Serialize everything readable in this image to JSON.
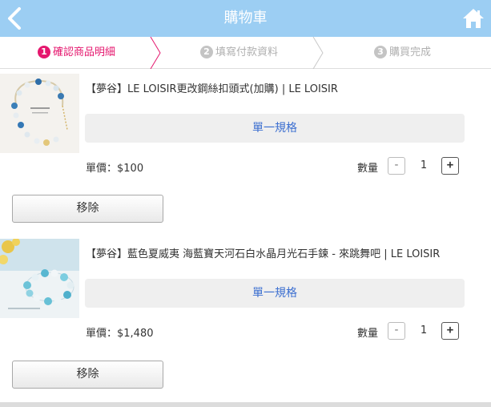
{
  "header": {
    "title": "購物車",
    "back_icon": "chevron-left-icon",
    "home_icon": "home-icon",
    "bg_color": "#9ccef3"
  },
  "steps": [
    {
      "num": "1",
      "label": "確認商品明細",
      "active": true
    },
    {
      "num": "2",
      "label": "填寫付款資料",
      "active": false
    },
    {
      "num": "3",
      "label": "購買完成",
      "active": false
    }
  ],
  "accent_color": "#e5176e",
  "items": [
    {
      "name": "【夢谷】LE LOISIR更改鋼絲扣頭式(加購) | LE LOISIR",
      "spec": "單一規格",
      "price_label": "單價：$100",
      "qty_label": "數量",
      "qty": "1",
      "minus": "-",
      "plus": "+",
      "remove": "移除"
    },
    {
      "name": "【夢谷】藍色夏威夷 海藍寶天河石白水晶月光石手鍊 - 來跳舞吧 | LE LOISIR",
      "spec": "單一規格",
      "price_label": "單價：$1,480",
      "qty_label": "數量",
      "qty": "1",
      "minus": "-",
      "plus": "+",
      "remove": "移除"
    }
  ]
}
